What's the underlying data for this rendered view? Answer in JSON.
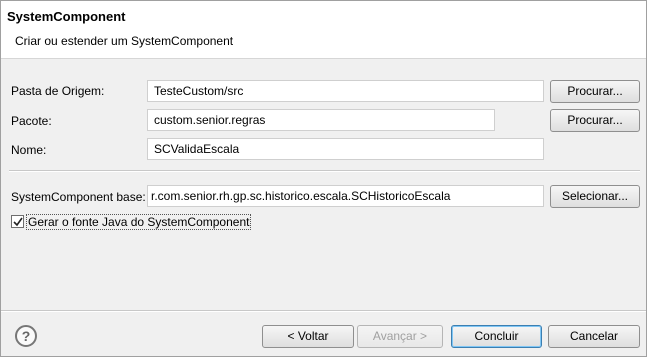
{
  "header": {
    "title": "SystemComponent",
    "subtitle": "Criar ou estender um SystemComponent"
  },
  "form": {
    "source_folder": {
      "label": "Pasta de Origem:",
      "value": "TesteCustom/src",
      "browse_label": "Procurar..."
    },
    "package": {
      "label": "Pacote:",
      "value": "custom.senior.regras",
      "browse_label": "Procurar..."
    },
    "name": {
      "label": "Nome:",
      "value": "SCValidaEscala"
    },
    "base": {
      "label": "SystemComponent base:",
      "value": "r.com.senior.rh.gp.sc.historico.escala.SCHistoricoEscala",
      "select_label": "Selecionar..."
    },
    "generate": {
      "label": "Gerar o fonte Java do SystemComponent",
      "checked": true
    }
  },
  "footer": {
    "help_icon": "question-circle",
    "back_label": "< Voltar",
    "next_label": "Avançar >",
    "finish_label": "Concluir",
    "cancel_label": "Cancelar"
  }
}
